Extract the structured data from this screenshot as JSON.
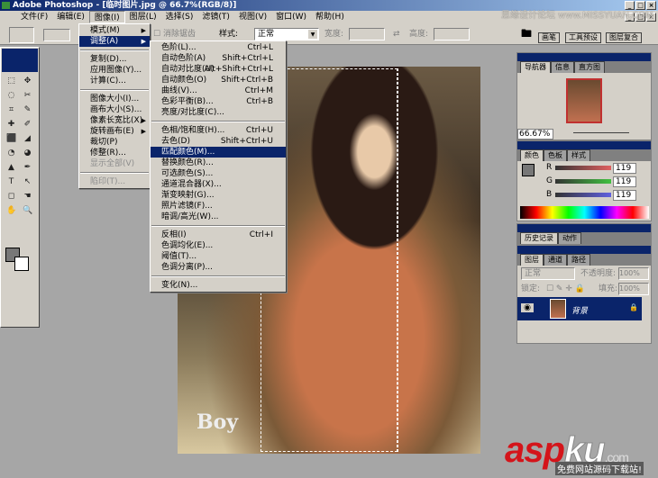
{
  "window": {
    "title": "Adobe Photoshop - [临时图片.jpg @ 66.7%(RGB/8)]",
    "watermark": "思缘设计论坛 www.MISSYUAN.COM"
  },
  "menubar": [
    "文件(F)",
    "编辑(E)",
    "图像(I)",
    "图层(L)",
    "选择(S)",
    "滤镜(T)",
    "视图(V)",
    "窗口(W)",
    "帮助(H)"
  ],
  "options": {
    "antialias": "消除锯齿",
    "style_label": "样式:",
    "style_value": "正常",
    "width_label": "宽度:",
    "height_label": "高度:",
    "palette_tabs": [
      "画笔",
      "工具预设",
      "图层复合"
    ]
  },
  "image_menu": [
    {
      "label": "模式(M)",
      "submenu": true
    },
    {
      "label": "调整(A)",
      "submenu": true,
      "highlighted": true
    },
    {
      "sep": true
    },
    {
      "label": "复制(D)..."
    },
    {
      "label": "应用图像(Y)..."
    },
    {
      "label": "计算(C)..."
    },
    {
      "sep": true
    },
    {
      "label": "图像大小(I)..."
    },
    {
      "label": "画布大小(S)..."
    },
    {
      "label": "像素长宽比(X)",
      "submenu": true
    },
    {
      "label": "旋转画布(E)",
      "submenu": true
    },
    {
      "label": "裁切(P)"
    },
    {
      "label": "修整(R)..."
    },
    {
      "label": "显示全部(V)",
      "disabled": true
    },
    {
      "sep": true
    },
    {
      "label": "陷印(T)...",
      "disabled": true
    }
  ],
  "adjust_menu": [
    {
      "label": "色阶(L)...",
      "shortcut": "Ctrl+L"
    },
    {
      "label": "自动色阶(A)",
      "shortcut": "Shift+Ctrl+L"
    },
    {
      "label": "自动对比度(U)",
      "shortcut": "Alt+Shift+Ctrl+L"
    },
    {
      "label": "自动颜色(O)",
      "shortcut": "Shift+Ctrl+B"
    },
    {
      "label": "曲线(V)...",
      "shortcut": "Ctrl+M"
    },
    {
      "label": "色彩平衡(B)...",
      "shortcut": "Ctrl+B"
    },
    {
      "label": "亮度/对比度(C)..."
    },
    {
      "sep": true
    },
    {
      "label": "色相/饱和度(H)...",
      "shortcut": "Ctrl+U"
    },
    {
      "label": "去色(D)",
      "shortcut": "Shift+Ctrl+U"
    },
    {
      "label": "匹配颜色(M)...",
      "highlighted": true
    },
    {
      "label": "替换颜色(R)..."
    },
    {
      "label": "可选颜色(S)..."
    },
    {
      "label": "通道混合器(X)..."
    },
    {
      "label": "渐变映射(G)..."
    },
    {
      "label": "照片滤镜(F)..."
    },
    {
      "label": "暗调/高光(W)..."
    },
    {
      "sep": true
    },
    {
      "label": "反相(I)",
      "shortcut": "Ctrl+I"
    },
    {
      "label": "色调均化(E)..."
    },
    {
      "label": "阈值(T)..."
    },
    {
      "label": "色调分离(P)..."
    },
    {
      "sep": true
    },
    {
      "label": "变化(N)..."
    }
  ],
  "canvas": {
    "logo_text": "Boy"
  },
  "navigator": {
    "tabs": [
      "导航器",
      "信息",
      "直方图"
    ],
    "zoom": "66.67%"
  },
  "color": {
    "tabs": [
      "颜色",
      "色板",
      "样式"
    ],
    "channels": [
      {
        "name": "R",
        "value": "119",
        "color": "#e06060"
      },
      {
        "name": "G",
        "value": "119",
        "color": "#40c040"
      },
      {
        "name": "B",
        "value": "119",
        "color": "#6060e0"
      }
    ],
    "foreground": "#777777",
    "background": "#ffffff"
  },
  "history": {
    "tabs": [
      "历史记录",
      "动作"
    ]
  },
  "layers": {
    "tabs": [
      "图层",
      "通道",
      "路径"
    ],
    "blend": "正常",
    "opacity_label": "不透明度:",
    "opacity": "100%",
    "lock_label": "锁定:",
    "fill_label": "填充:",
    "fill": "100%",
    "items": [
      {
        "name": "背景",
        "locked": true
      }
    ]
  },
  "site_watermark": {
    "brand": "aspku",
    "tld": ".com",
    "tagline": "免费网站源码下载站!"
  }
}
